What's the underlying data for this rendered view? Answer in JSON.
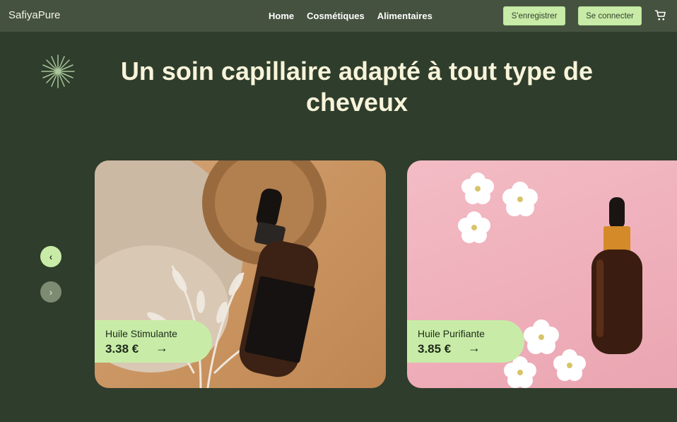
{
  "brand": "SafiyaPure",
  "nav": {
    "links": [
      "Home",
      "Cosmétiques",
      "Alimentaires"
    ],
    "register_label": "S'enregistrer",
    "login_label": "Se connecter"
  },
  "icons": {
    "cart": "shopping-cart-icon",
    "decor": "starburst-icon",
    "prev": "chevron-left-icon",
    "next": "chevron-right-icon",
    "card_arrow": "arrow-right-icon"
  },
  "hero": {
    "title": "Un soin capillaire adapté à tout type de cheveux"
  },
  "carousel": {
    "prev_glyph": "‹",
    "next_glyph": "›",
    "products": [
      {
        "name": "Huile Stimulante",
        "price": "3.38 €",
        "arrow": "→"
      },
      {
        "name": "Huile Purifiante",
        "price": "3.85 €",
        "arrow": "→"
      }
    ]
  },
  "colors": {
    "background": "#2f3d2c",
    "navbar": "#465240",
    "accent": "#c8eca7",
    "title": "#f8f4da"
  }
}
